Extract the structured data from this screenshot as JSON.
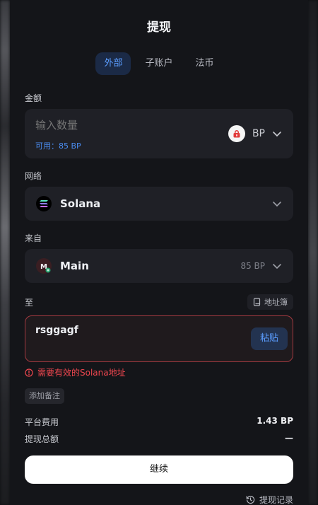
{
  "header": {
    "title": "提现"
  },
  "tabs": [
    {
      "label": "外部",
      "active": true
    },
    {
      "label": "子账户",
      "active": false
    },
    {
      "label": "法币",
      "active": false
    }
  ],
  "amount": {
    "label": "金额",
    "placeholder": "输入数量",
    "available": "可用：85 BP",
    "coin": "BP",
    "coin_icon": "bp-coin-icon"
  },
  "network": {
    "label": "网络",
    "value": "Solana",
    "icon": "solana-icon"
  },
  "source": {
    "label": "来自",
    "value": "Main",
    "balance": "85 BP",
    "icon": "main-account-icon"
  },
  "destination": {
    "label": "至",
    "address_book": "地址簿",
    "address": "rsggagf",
    "paste": "粘贴",
    "error": "需要有效的Solana地址"
  },
  "memo": {
    "label": "添加备注"
  },
  "fees": {
    "platform_fee_label": "平台费用",
    "platform_fee_value": "1.43 BP",
    "total_label": "提现总额",
    "total_value": "—"
  },
  "actions": {
    "continue": "继续",
    "history": "提现记录"
  },
  "colors": {
    "accent": "#5b9dff",
    "error": "#f0474f",
    "panel": "#141519",
    "field": "#1f2026"
  }
}
